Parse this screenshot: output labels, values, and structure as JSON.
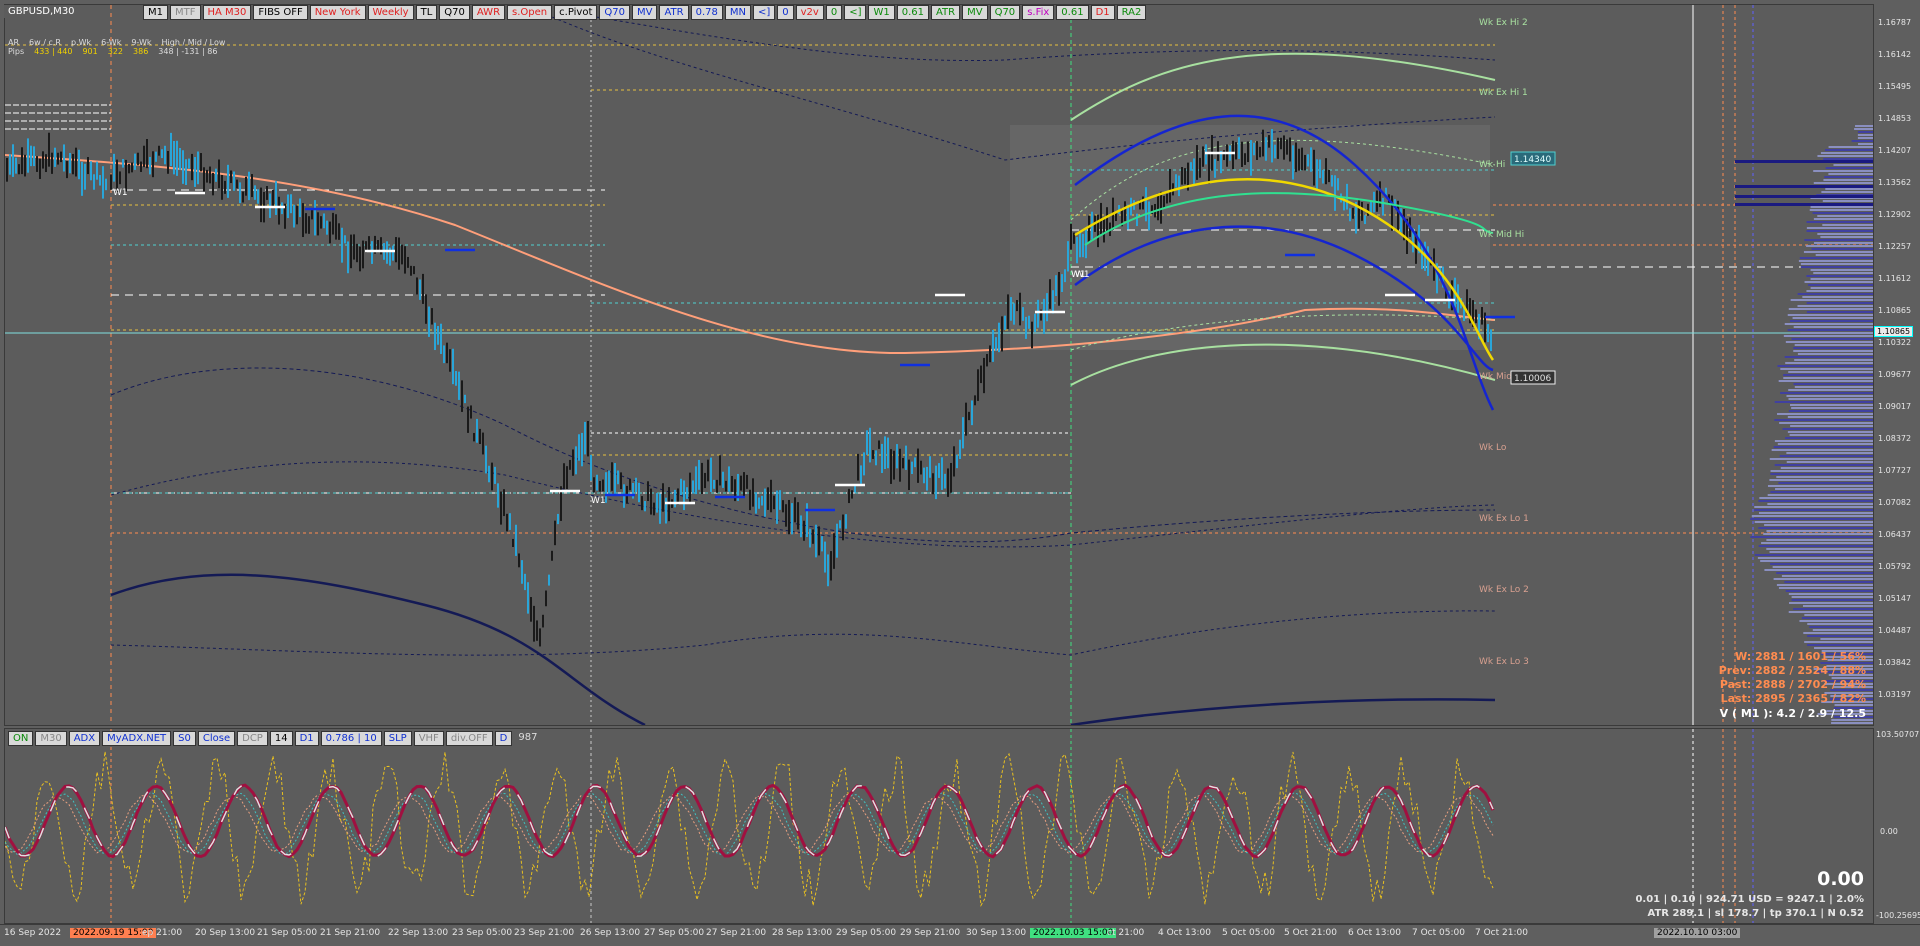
{
  "chart": {
    "symbol": "GBPUSD,M30",
    "price_ticks": [
      "1.16787",
      "1.16142",
      "1.15495",
      "1.14853",
      "1.14207",
      "1.13562",
      "1.12902",
      "1.12257",
      "1.11612",
      "1.10865",
      "1.10322",
      "1.09677",
      "1.09017",
      "1.08372",
      "1.07727",
      "1.07082",
      "1.06437",
      "1.05792",
      "1.05147",
      "1.04487",
      "1.03842",
      "1.03197"
    ],
    "current_price": "1.10865",
    "wk_hi_price": "1.14340",
    "wk_lo_price": "1.10006",
    "levels": [
      "Wk Ex Hi 2",
      "Wk Ex Hi 1",
      "Wk Hi",
      "Wk Mid Hi",
      "Wk Mid",
      "Wk Lo",
      "Wk Ex Lo 1",
      "Wk Ex Lo 2",
      "Wk Ex Lo 3"
    ],
    "week_markers": [
      "W1",
      "W1",
      "W1",
      "W1"
    ]
  },
  "toolbar": {
    "items": [
      {
        "label": "M1",
        "style": ""
      },
      {
        "label": "MTF",
        "style": "gray"
      },
      {
        "label": "HA M30",
        "style": "red"
      },
      {
        "label": "FIBS OFF",
        "style": ""
      },
      {
        "label": "New York",
        "style": "red"
      },
      {
        "label": "Weekly",
        "style": "red"
      },
      {
        "label": "TL",
        "style": ""
      },
      {
        "label": "Q70",
        "style": ""
      },
      {
        "label": "AWR",
        "style": "red"
      },
      {
        "label": "s.Open",
        "style": "red"
      },
      {
        "label": "c.Pivot",
        "style": ""
      },
      {
        "label": "Q70",
        "style": "blue"
      },
      {
        "label": "MV",
        "style": "blue"
      },
      {
        "label": "ATR",
        "style": "blue"
      },
      {
        "label": "0.78",
        "style": "blue"
      },
      {
        "label": "MN",
        "style": "blue"
      },
      {
        "label": "<]",
        "style": "blue"
      },
      {
        "label": "0",
        "style": "blue"
      },
      {
        "label": "v2v",
        "style": "red"
      },
      {
        "label": "0",
        "style": "green"
      },
      {
        "label": "<]",
        "style": "green"
      },
      {
        "label": "W1",
        "style": "green"
      },
      {
        "label": "0.61",
        "style": "green"
      },
      {
        "label": "ATR",
        "style": "green"
      },
      {
        "label": "MV",
        "style": "green"
      },
      {
        "label": "Q70",
        "style": "green"
      },
      {
        "label": "s.Fix",
        "style": "mag"
      },
      {
        "label": "0.61",
        "style": "green"
      },
      {
        "label": "D1",
        "style": "red"
      },
      {
        "label": "RA2",
        "style": "green"
      }
    ]
  },
  "info_panel": {
    "row1": [
      "AR",
      "6w / c.R",
      "p.Wk",
      "6-Wk",
      "9-Wk",
      "High / Mid / Low"
    ],
    "row2": [
      "Pips",
      "433 | 440",
      "901",
      "322",
      "386",
      "348  |  -131  |  86"
    ]
  },
  "stats": {
    "w": "W: 2881 / 1601 / 56%",
    "prev": "Prev: 2882 / 2524 / 88%",
    "past": "Past: 2888 / 2702 / 94%",
    "last": "Last: 2895 / 2365 / 82%",
    "v": "V ( M1 ): 4.2 / 2.9 / 12.5"
  },
  "subwindow": {
    "buttons": [
      {
        "label": "ON",
        "style": "green"
      },
      {
        "label": "M30",
        "style": "gray"
      },
      {
        "label": "ADX",
        "style": "blue"
      },
      {
        "label": "MyADX.NET",
        "style": "blue"
      },
      {
        "label": "S0",
        "style": "blue"
      },
      {
        "label": "Close",
        "style": "blue"
      },
      {
        "label": "DCP",
        "style": "gray"
      },
      {
        "label": "14",
        "style": ""
      },
      {
        "label": "D1",
        "style": "blue"
      },
      {
        "label": "0.786 | 10",
        "style": "blue"
      },
      {
        "label": "SLP",
        "style": "blue"
      },
      {
        "label": "VHF",
        "style": "gray"
      },
      {
        "label": "div.OFF",
        "style": "gray"
      },
      {
        "label": "D",
        "style": "blue"
      }
    ],
    "tail_value": "987",
    "scale_top": "103.50707",
    "scale_mid": "0.00",
    "scale_bottom": "-100.25695",
    "big_value": "0.00",
    "info1": "0.01  |  0.10  |  924.71 USD = 9247.1  |  2.0%",
    "info2": "ATR 289.1  |  sl 178.7  |  tp 370.1  |  N 0.52"
  },
  "time_axis": {
    "labels": [
      "16 Sep 2022",
      "2022.09.19 15:00",
      "ep 21:00",
      "20 Sep 13:00",
      "21 Sep 05:00",
      "21 Sep 21:00",
      "22 Sep 13:00",
      "23 Sep 05:00",
      "23 Sep 21:00",
      "26 Sep 13:00",
      "27 Sep 05:00",
      "27 Sep 21:00",
      "28 Sep 13:00",
      "29 Sep 05:00",
      "29 Sep 21:00",
      "30 Sep 13:00",
      "2022.10.03 15:00",
      "ct 21:00",
      "4 Oct 13:00",
      "5 Oct 05:00",
      "5 Oct 21:00",
      "6 Oct 13:00",
      "7 Oct 05:00",
      "7 Oct 21:00",
      "2022.10.10 03:00"
    ]
  }
}
